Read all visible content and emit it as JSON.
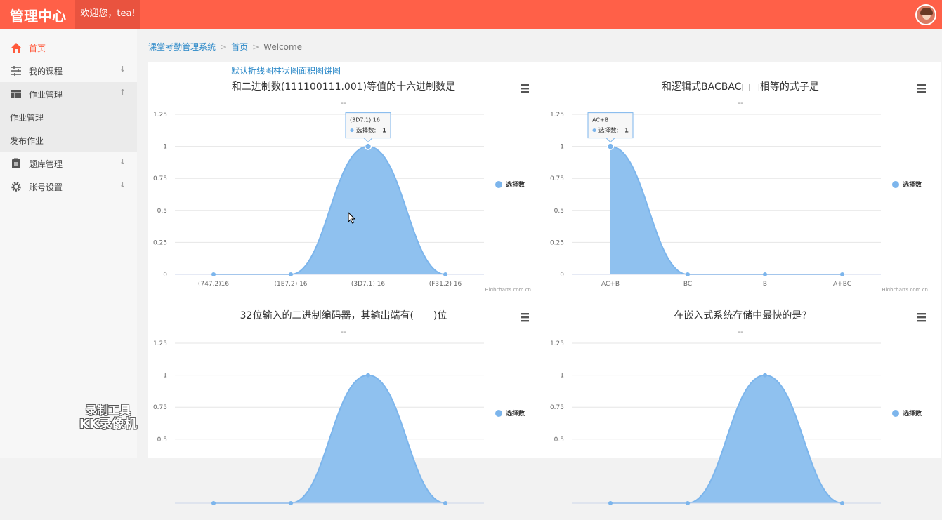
{
  "header": {
    "brand": "管理中心",
    "welcome": "欢迎您，tea!"
  },
  "sidebar": {
    "items": [
      {
        "label": "首页",
        "icon": "home-icon",
        "active": true,
        "arrow": ""
      },
      {
        "label": "我的课程",
        "icon": "sliders-icon",
        "active": false,
        "arrow": "↓"
      },
      {
        "label": "作业管理",
        "icon": "table-icon",
        "active": false,
        "arrow": "↑"
      },
      {
        "label": "题库管理",
        "icon": "clipboard-icon",
        "active": false,
        "arrow": "↓"
      },
      {
        "label": "账号设置",
        "icon": "gear-icon",
        "active": false,
        "arrow": "↓"
      }
    ],
    "subitems": [
      {
        "label": "作业管理"
      },
      {
        "label": "发布作业"
      }
    ]
  },
  "breadcrumb": {
    "system": "课堂考勤管理系统",
    "home": "首页",
    "current": "Welcome",
    "sep": ">"
  },
  "panel": {
    "title": "默认折线图柱状图面积图饼图"
  },
  "watermark": {
    "line1": "录制工具",
    "line2": "KK录像机"
  },
  "chart_data": [
    {
      "type": "area",
      "title": "和二进制数(111100111.001)等值的十六进制数是",
      "subtitle": "--",
      "categories": [
        "(747.2)16",
        "(1E7.2) 16",
        "(3D7.1) 16",
        "(F31.2) 16"
      ],
      "series": [
        {
          "name": "选择数",
          "values": [
            0,
            0,
            1,
            0
          ]
        }
      ],
      "ylim": [
        0,
        1.25
      ],
      "yticks": [
        "1.25",
        "1",
        "0.75",
        "0.5",
        "0.25",
        "0"
      ],
      "legend": "right",
      "credit": "Highcharts.com.cn",
      "tooltip": {
        "index": 2,
        "header": "(3D7.1) 16",
        "label": "选择数",
        "value": "1"
      }
    },
    {
      "type": "area",
      "title": "和逻辑式BACBAC□□相等的式子是",
      "subtitle": "--",
      "categories": [
        "AC+B",
        "BC",
        "B",
        "A+BC"
      ],
      "series": [
        {
          "name": "选择数",
          "values": [
            1,
            0,
            0,
            0
          ]
        }
      ],
      "ylim": [
        0,
        1.25
      ],
      "yticks": [
        "1.25",
        "1",
        "0.75",
        "0.5",
        "0.25",
        "0"
      ],
      "legend": "right",
      "credit": "Highcharts.com.cn",
      "tooltip": {
        "index": 0,
        "header": "AC+B",
        "label": "选择数",
        "value": "1"
      }
    },
    {
      "type": "area",
      "title": "32位输入的二进制编码器，其输出端有(　　)位",
      "subtitle": "--",
      "categories": [],
      "series": [
        {
          "name": "选择数",
          "values": [
            0,
            0,
            1,
            0
          ]
        }
      ],
      "ylim": [
        0,
        1.25
      ],
      "yticks": [
        "1.25",
        "1",
        "0.75",
        "0.5"
      ],
      "legend": "right"
    },
    {
      "type": "area",
      "title": "在嵌入式系统存储中最快的是?",
      "subtitle": "--",
      "categories": [],
      "series": [
        {
          "name": "选择数",
          "values": [
            0,
            0,
            1,
            0
          ]
        }
      ],
      "ylim": [
        0,
        1.25
      ],
      "yticks": [
        "1.25",
        "1",
        "0.75",
        "0.5"
      ],
      "legend": "right"
    }
  ]
}
